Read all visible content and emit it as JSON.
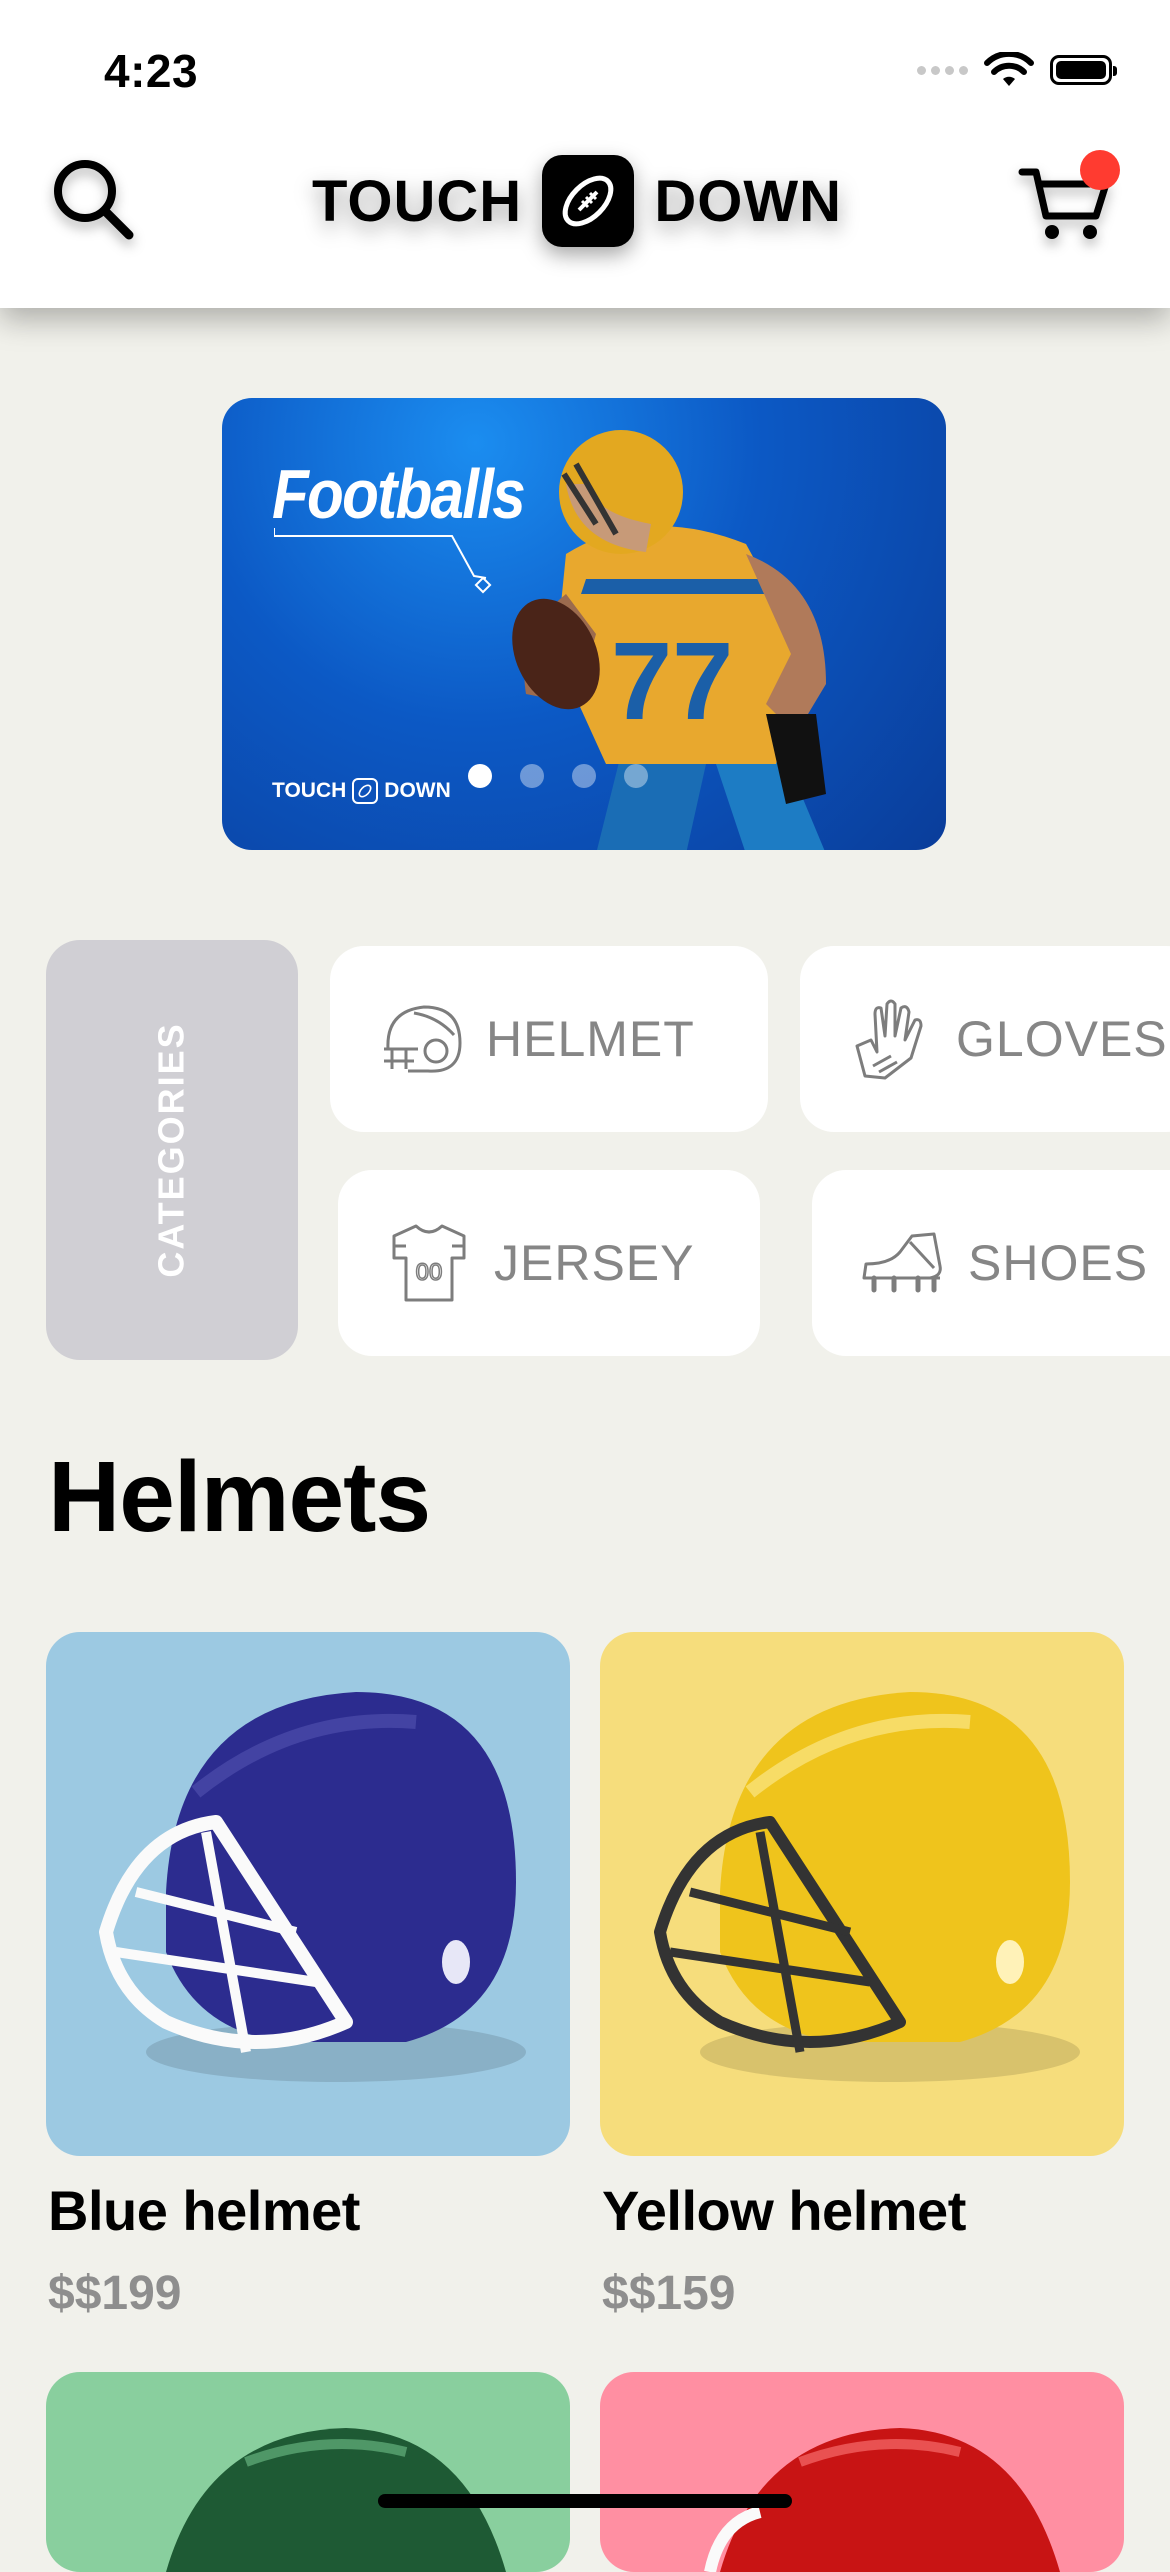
{
  "status_bar": {
    "time": "4:23"
  },
  "header": {
    "logo_left": "TOUCH",
    "logo_right": "DOWN",
    "search_icon": "search-icon",
    "cart_icon": "cart-icon",
    "cart_badge_color": "#ff3b30"
  },
  "banner": {
    "title": "Footballs",
    "brand_left": "TOUCH",
    "brand_right": "DOWN",
    "page_count": 4,
    "active_page": 1
  },
  "categories": {
    "label": "CATEGORIES",
    "items": [
      {
        "label": "HELMET",
        "icon": "helmet-icon"
      },
      {
        "label": "GLOVES",
        "icon": "gloves-icon"
      },
      {
        "label": "JERSEY",
        "icon": "jersey-icon"
      },
      {
        "label": "SHOES",
        "icon": "shoes-icon"
      }
    ]
  },
  "section": {
    "title": "Helmets"
  },
  "products": [
    {
      "name": "Blue helmet",
      "price": "$$199",
      "bg": "#9cc9e2",
      "shell": "#2c2c8f"
    },
    {
      "name": "Yellow helmet",
      "price": "$$159",
      "bg": "#f6dd7c",
      "shell": "#efc41c"
    },
    {
      "bg": "#89cf9e",
      "shell": "#1e5a34"
    },
    {
      "bg": "#ff8fa2",
      "shell": "#c81414"
    }
  ]
}
